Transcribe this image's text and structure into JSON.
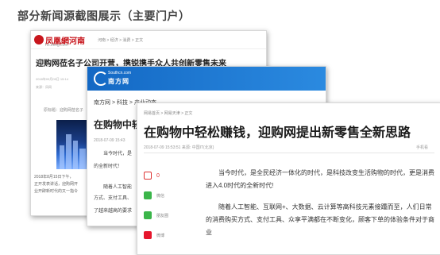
{
  "slide": {
    "title": "部分新闻源截图展示（主要门户）"
  },
  "ifeng": {
    "logo_name": "凤凰網河南",
    "logo_site": "hn.ifeng.com",
    "breadcrumb": "河南 > 经济 > 消费 > 正文",
    "headline": "迎购网莅名子公司开营，携锐携手众人共创新零售未来",
    "meta": "2018年09月05日 15:14",
    "source": "来源：凤网",
    "original": "原标题：迎购网莅名子",
    "body_line1": "2018年8月15日下午，",
    "body_line2": "正开发表讲话，迎购网开",
    "body_line3": "业开辟新时代的又一指令"
  },
  "south": {
    "domain": "Southcn.com",
    "name": "南方网",
    "breadcrumb": "南方网 > 科技 > 产业动态",
    "headline": "在购物中轻松赚钱",
    "time": "2018-07-09 15:43",
    "p1": "当今时代，是",
    "p2": "的全新时代！",
    "p3": "随着人工智能",
    "p4": "方式、支付工具、",
    "p5": "了越来越高的要求"
  },
  "tianjin": {
    "breadcrumb": "网易首页 > 网易天津 > 正文",
    "headline": "在购物中轻松赚钱，迎购网提出新零售全新思路",
    "meta": "2018-07-09 15:53:51  来源: 中国IT(北京)",
    "mobile": "手机看",
    "comment_count": "0",
    "share_wechat": "微信",
    "share_moments": "朋友圈",
    "share_weibo": "微博",
    "para1": "当今时代，是全民经济一体化的时代，是科技改变生活购物的时代，更是消费进入4.0时代的全新时代!",
    "para2": "随着人工智能、互联网+、大数据、云计算等高科技元素接踵而至，人们日常的消费购买方式、支付工具、众享平满都在不断变化，顾客下单的体验条件对于商业"
  }
}
